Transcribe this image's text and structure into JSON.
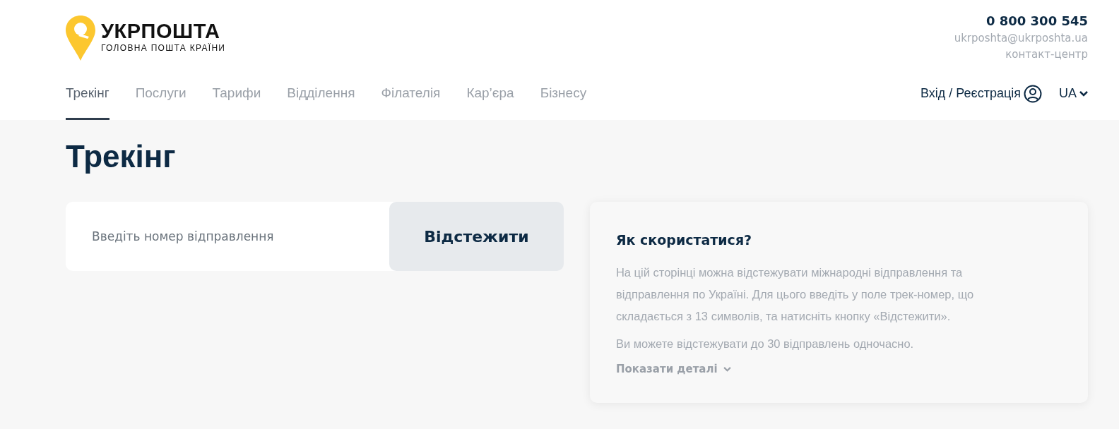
{
  "logo": {
    "name": "УКРПОШТА",
    "tagline": "ГОЛОВНА ПОШТА КРАЇНИ"
  },
  "contacts": {
    "phone": "0 800 300 545",
    "email": "ukrposhta@ukrposhta.ua",
    "label": "контакт-центр"
  },
  "nav": [
    {
      "label": "Трекінг",
      "selected": true
    },
    {
      "label": "Послуги",
      "selected": false
    },
    {
      "label": "Тарифи",
      "selected": false
    },
    {
      "label": "Відділення",
      "selected": false
    },
    {
      "label": "Філателія",
      "selected": false
    },
    {
      "label": "Кар’єра",
      "selected": false
    },
    {
      "label": "Бізнесу",
      "selected": false
    }
  ],
  "login": "Вхід / Реєстрація",
  "language": "UA",
  "page_title": "Трекінг",
  "tracking": {
    "placeholder": "Введіть номер відправлення",
    "button": "Відстежити"
  },
  "help": {
    "title": "Як скористатися?",
    "paragraphs": [
      "На цій сторінці можна відстежувати міжнародні відправлення та відправлення по Україні. Для цього введіть у поле трек-номер, що складається з 13 символів, та натисніть кнопку «Відстежити».",
      "Ви можете відстежувати до 30 відправлень одночасно."
    ],
    "toggle": "Показати деталі"
  }
}
